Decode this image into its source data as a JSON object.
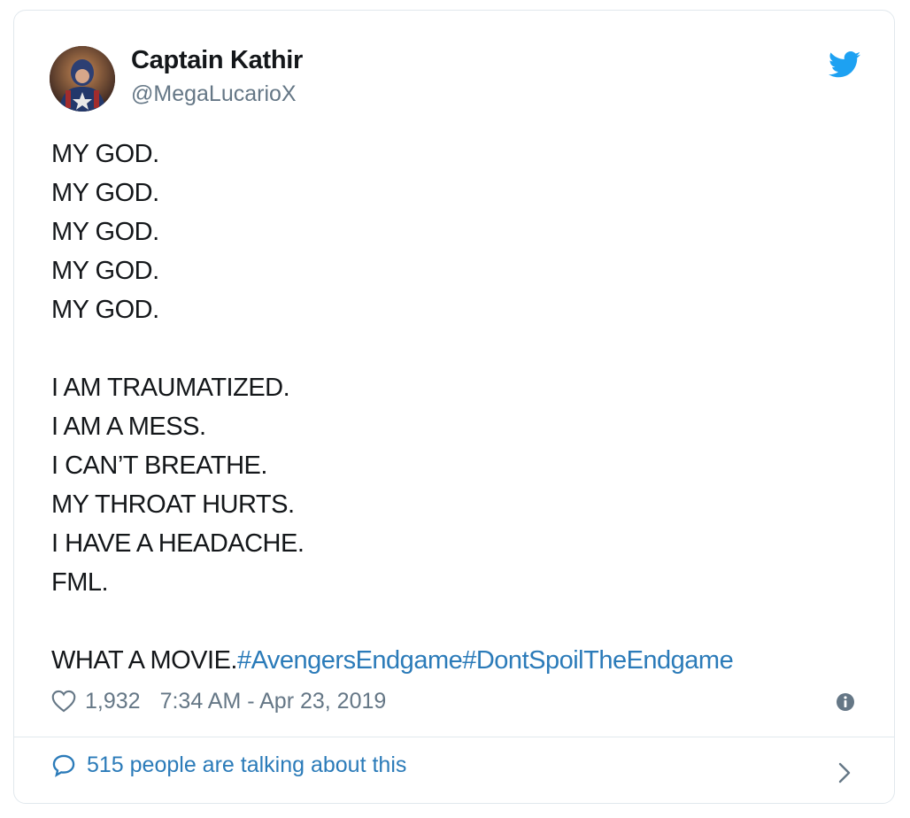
{
  "author": {
    "display_name": "Captain Kathir",
    "handle": "@MegaLucarioX"
  },
  "tweet": {
    "lines": [
      "MY GOD.",
      "MY GOD.",
      "MY GOD.",
      "MY GOD.",
      "MY GOD.",
      "",
      "I AM TRAUMATIZED.",
      "I AM A MESS.",
      "I CAN’T BREATHE.",
      "MY THROAT HURTS.",
      "I HAVE A HEADACHE.",
      "FML.",
      ""
    ],
    "final_text": "WHAT A MOVIE.",
    "hashtags": [
      "#AvengersEndgame",
      "#DontSpoilTheEndgame"
    ]
  },
  "meta": {
    "likes": "1,932",
    "timestamp": "7:34 AM - Apr 23, 2019"
  },
  "footer": {
    "talking_text": "515 people are talking about this"
  },
  "icons": {
    "brand": "twitter-bird-icon",
    "like": "heart-icon",
    "info": "info-icon",
    "conversation": "speech-bubble-icon",
    "expand": "chevron-right-icon"
  },
  "colors": {
    "text": "#14171a",
    "secondary": "#657786",
    "link": "#2b7bb9",
    "twitter_blue": "#1da1f2",
    "border": "#e1e8ed"
  }
}
